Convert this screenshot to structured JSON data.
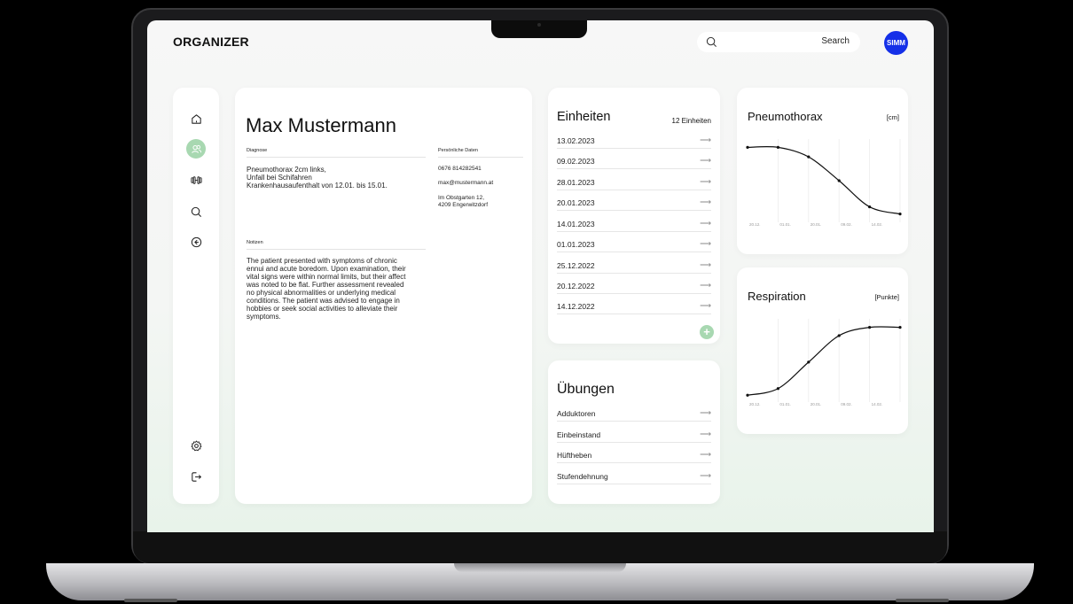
{
  "app": {
    "brand": "ORGANIZER",
    "search_label": "Search",
    "avatar_text": "SIMM",
    "accent": "#a8d8b1",
    "avatar_color": "#1530e8"
  },
  "sidebar": {
    "items": [
      {
        "name": "home-icon",
        "active": false
      },
      {
        "name": "users-icon",
        "active": true
      },
      {
        "name": "dumbbell-icon",
        "active": false
      },
      {
        "name": "search-icon",
        "active": false
      },
      {
        "name": "back-icon",
        "active": false
      }
    ],
    "bottom": [
      {
        "name": "settings-icon"
      },
      {
        "name": "logout-icon"
      }
    ]
  },
  "patient": {
    "name": "Max Mustermann",
    "diagnose_label": "Diagnose",
    "diagnose": [
      "Pneumothorax 2cm links,",
      "Unfall bei Schifahren",
      "Krankenhausaufenthalt von 12.01. bis 15.01."
    ],
    "personal_label": "Persönliche Daten",
    "phone": "0676 814282541",
    "email": "max@mustermann.at",
    "address_1": "Im Obstgarten 12,",
    "address_2": "4209 Engerwitzdorf",
    "notes_label": "Notizen",
    "notes": [
      "The patient presented with symptoms of chronic",
      "ennui and acute boredom. Upon examination, their",
      "vital signs were within normal limits, but their affect",
      "was noted to be flat. Further assessment revealed",
      "no physical abnormalities or underlying medical",
      "conditions. The patient was advised to engage in",
      "hobbies or seek social activities to alleviate their",
      "symptoms."
    ]
  },
  "einheiten": {
    "title": "Einheiten",
    "count": "12 Einheiten",
    "items": [
      "13.02.2023",
      "09.02.2023",
      "28.01.2023",
      "20.01.2023",
      "14.01.2023",
      "01.01.2023",
      "25.12.2022",
      "20.12.2022",
      "14.12.2022"
    ],
    "arrow": "⟶",
    "add": "+"
  },
  "uebungen": {
    "title": "Übungen",
    "items": [
      "Adduktoren",
      "Einbeinstand",
      "Hüftheben",
      "Stufendehnung"
    ],
    "arrow": "⟶"
  },
  "chart_data": [
    {
      "type": "line",
      "title": "Pneumothorax",
      "unit": "[cm]",
      "categories": [
        "20.12.",
        "01.01.",
        "20.01.",
        "09.02.",
        "14.02."
      ],
      "x_positions": [
        0,
        1,
        2,
        3,
        4,
        5
      ],
      "values": [
        2.0,
        2.0,
        1.8,
        1.3,
        0.75,
        0.6
      ],
      "ylim": [
        0.5,
        2.1
      ],
      "grid": true
    },
    {
      "type": "line",
      "title": "Respiration",
      "unit": "[Punkte]",
      "categories": [
        "20.12.",
        "01.01.",
        "20.01.",
        "09.02.",
        "14.02."
      ],
      "x_positions": [
        0,
        1,
        2,
        3,
        4,
        5
      ],
      "values": [
        1.0,
        1.2,
        2.0,
        2.8,
        3.05,
        3.05
      ],
      "ylim": [
        0.9,
        3.2
      ],
      "grid": true
    }
  ]
}
